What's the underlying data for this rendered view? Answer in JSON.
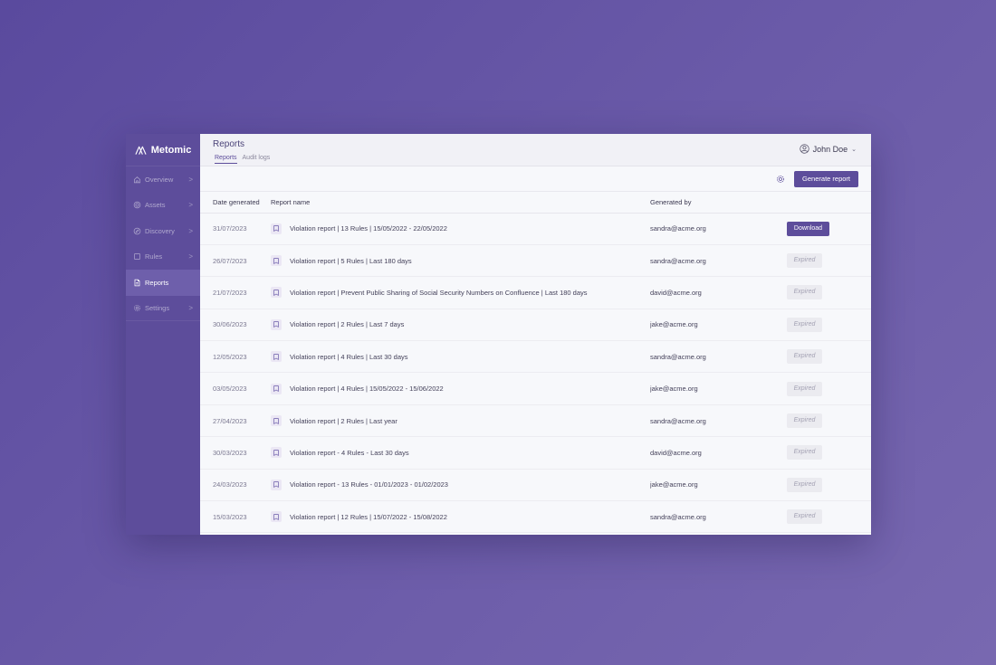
{
  "brand": {
    "name": "Metomic"
  },
  "sidebar": {
    "items": [
      {
        "label": "Overview",
        "icon": "home-icon",
        "chevron": true,
        "active": false
      },
      {
        "label": "Assets",
        "icon": "target-icon",
        "chevron": true,
        "active": false
      },
      {
        "label": "Discovery",
        "icon": "compass-icon",
        "chevron": true,
        "active": false
      },
      {
        "label": "Rules",
        "icon": "rules-icon",
        "chevron": true,
        "active": false
      },
      {
        "label": "Reports",
        "icon": "document-icon",
        "chevron": false,
        "active": true
      },
      {
        "label": "Settings",
        "icon": "gear-icon",
        "chevron": true,
        "active": false
      }
    ],
    "chevron_glyph": ">"
  },
  "header": {
    "title": "Reports",
    "tabs": [
      {
        "label": "Reports",
        "active": true
      },
      {
        "label": "Audit logs",
        "active": false
      }
    ],
    "user_name": "John Doe",
    "caret": "⌄"
  },
  "toolbar": {
    "generate_label": "Generate report"
  },
  "table": {
    "columns": [
      "Date generated",
      "Report name",
      "Generated by",
      ""
    ],
    "rows": [
      {
        "date": "31/07/2023",
        "name": "Violation report | 13 Rules | 15/05/2022 - 22/05/2022",
        "by": "sandra@acme.org",
        "action": "Download"
      },
      {
        "date": "26/07/2023",
        "name": "Violation report | 5 Rules | Last 180 days",
        "by": "sandra@acme.org",
        "action": "Expired"
      },
      {
        "date": "21/07/2023",
        "name": "Violation report | Prevent Public Sharing of Social Security Numbers on Confluence | Last 180 days",
        "by": "david@acme.org",
        "action": "Expired"
      },
      {
        "date": "30/06/2023",
        "name": "Violation report | 2 Rules | Last 7 days",
        "by": "jake@acme.org",
        "action": "Expired"
      },
      {
        "date": "12/05/2023",
        "name": "Violation report | 4 Rules | Last 30 days",
        "by": "sandra@acme.org",
        "action": "Expired"
      },
      {
        "date": "03/05/2023",
        "name": "Violation report | 4 Rules | 15/05/2022 - 15/06/2022",
        "by": "jake@acme.org",
        "action": "Expired"
      },
      {
        "date": "27/04/2023",
        "name": "Violation report | 2 Rules | Last year",
        "by": "sandra@acme.org",
        "action": "Expired"
      },
      {
        "date": "30/03/2023",
        "name": "Violation report - 4 Rules - Last 30 days",
        "by": "david@acme.org",
        "action": "Expired"
      },
      {
        "date": "24/03/2023",
        "name": "Violation report - 13 Rules - 01/01/2023 - 01/02/2023",
        "by": "jake@acme.org",
        "action": "Expired"
      },
      {
        "date": "15/03/2023",
        "name": "Violation report | 12 Rules | 15/07/2022 - 15/08/2022",
        "by": "sandra@acme.org",
        "action": "Expired"
      }
    ]
  },
  "colors": {
    "accent": "#5d4d9b",
    "sidebar_bg": "#5d4d9b",
    "sidebar_active": "#6e5fab",
    "content_bg": "#f7f8fb",
    "expired_bg": "#ebebf0"
  }
}
